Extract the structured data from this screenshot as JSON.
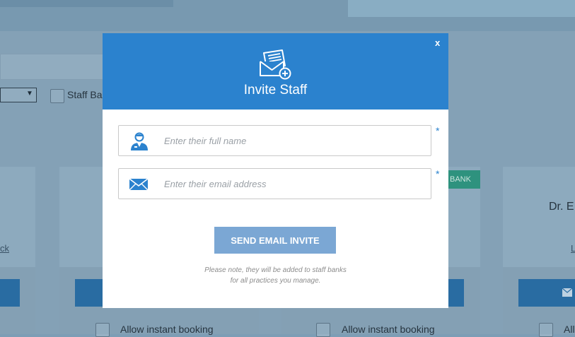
{
  "background": {
    "filter_label": "Staff Ba",
    "link_left": "ck",
    "doctor_name": "Dr. E",
    "link_right": "L",
    "bank_badge": "BANK",
    "allow_booking_1": "Allow instant booking",
    "allow_booking_2": "Allow instant booking",
    "allow_booking_3": "Allow"
  },
  "modal": {
    "close_label": "x",
    "title": "Invite Staff",
    "name_field": {
      "placeholder": "Enter their full name",
      "required_mark": "*"
    },
    "email_field": {
      "placeholder": "Enter their email address",
      "required_mark": "*"
    },
    "submit_label": "SEND EMAIL INVITE",
    "note_line1": "Please note, they will be added to staff banks",
    "note_line2": "for all practices you manage."
  },
  "colors": {
    "header": "#2b82ce",
    "button": "#7ba7d4",
    "icon": "#2b82ce"
  },
  "icons": {
    "header": "envelope-plus-icon",
    "name": "user-icon",
    "email": "envelope-icon"
  }
}
